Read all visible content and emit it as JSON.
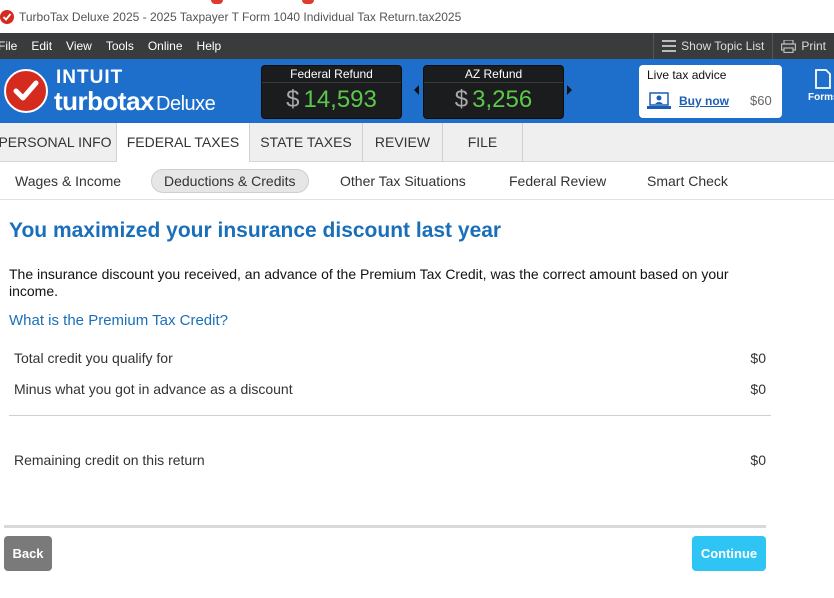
{
  "window": {
    "title": "TurboTax Deluxe 2025 - 2025 Taxpayer T Form 1040  Individual Tax Return.tax2025"
  },
  "menubar": {
    "items": [
      "File",
      "Edit",
      "View",
      "Tools",
      "Online",
      "Help"
    ],
    "show_topic_list": "Show Topic List",
    "print": "Print"
  },
  "header": {
    "brand_intuit": "INTUIT",
    "brand_product": "turbotax",
    "brand_edition": "Deluxe",
    "federal_refund": {
      "label": "Federal Refund",
      "currency": "$",
      "amount": "14,593"
    },
    "state_refund": {
      "label": "AZ Refund",
      "currency": "$",
      "amount": "3,256"
    },
    "advice": {
      "label": "Live tax advice",
      "buy_now": "Buy now",
      "price": "$60"
    },
    "forms_label": "Forms"
  },
  "main_tabs": [
    {
      "label": "PERSONAL INFO"
    },
    {
      "label": "FEDERAL TAXES"
    },
    {
      "label": "STATE TAXES"
    },
    {
      "label": "REVIEW"
    },
    {
      "label": "FILE"
    }
  ],
  "sub_tabs": [
    {
      "label": "Wages & Income"
    },
    {
      "label": "Deductions & Credits"
    },
    {
      "label": "Other Tax Situations"
    },
    {
      "label": "Federal Review"
    },
    {
      "label": "Smart Check"
    }
  ],
  "content": {
    "heading": "You maximized your insurance discount last year",
    "description": "The insurance discount you received, an advance of the Premium Tax Credit, was the correct amount based on your income.",
    "learn_more": "What is the Premium Tax Credit?",
    "rows": [
      {
        "label": "Total credit you qualify for",
        "amount": "$0"
      },
      {
        "label": "Minus what you got in advance as a discount",
        "amount": "$0"
      },
      {
        "label": "Remaining credit on this return",
        "amount": "$0"
      }
    ]
  },
  "footer": {
    "back_label": "Back",
    "continue_label": "Continue"
  },
  "colors": {
    "brand_blue": "#1e6fcb",
    "refund_green": "#5cc84a",
    "heading_blue": "#1a6fba",
    "continue_blue": "#2ec5f5",
    "logo_red": "#d52b1e"
  }
}
